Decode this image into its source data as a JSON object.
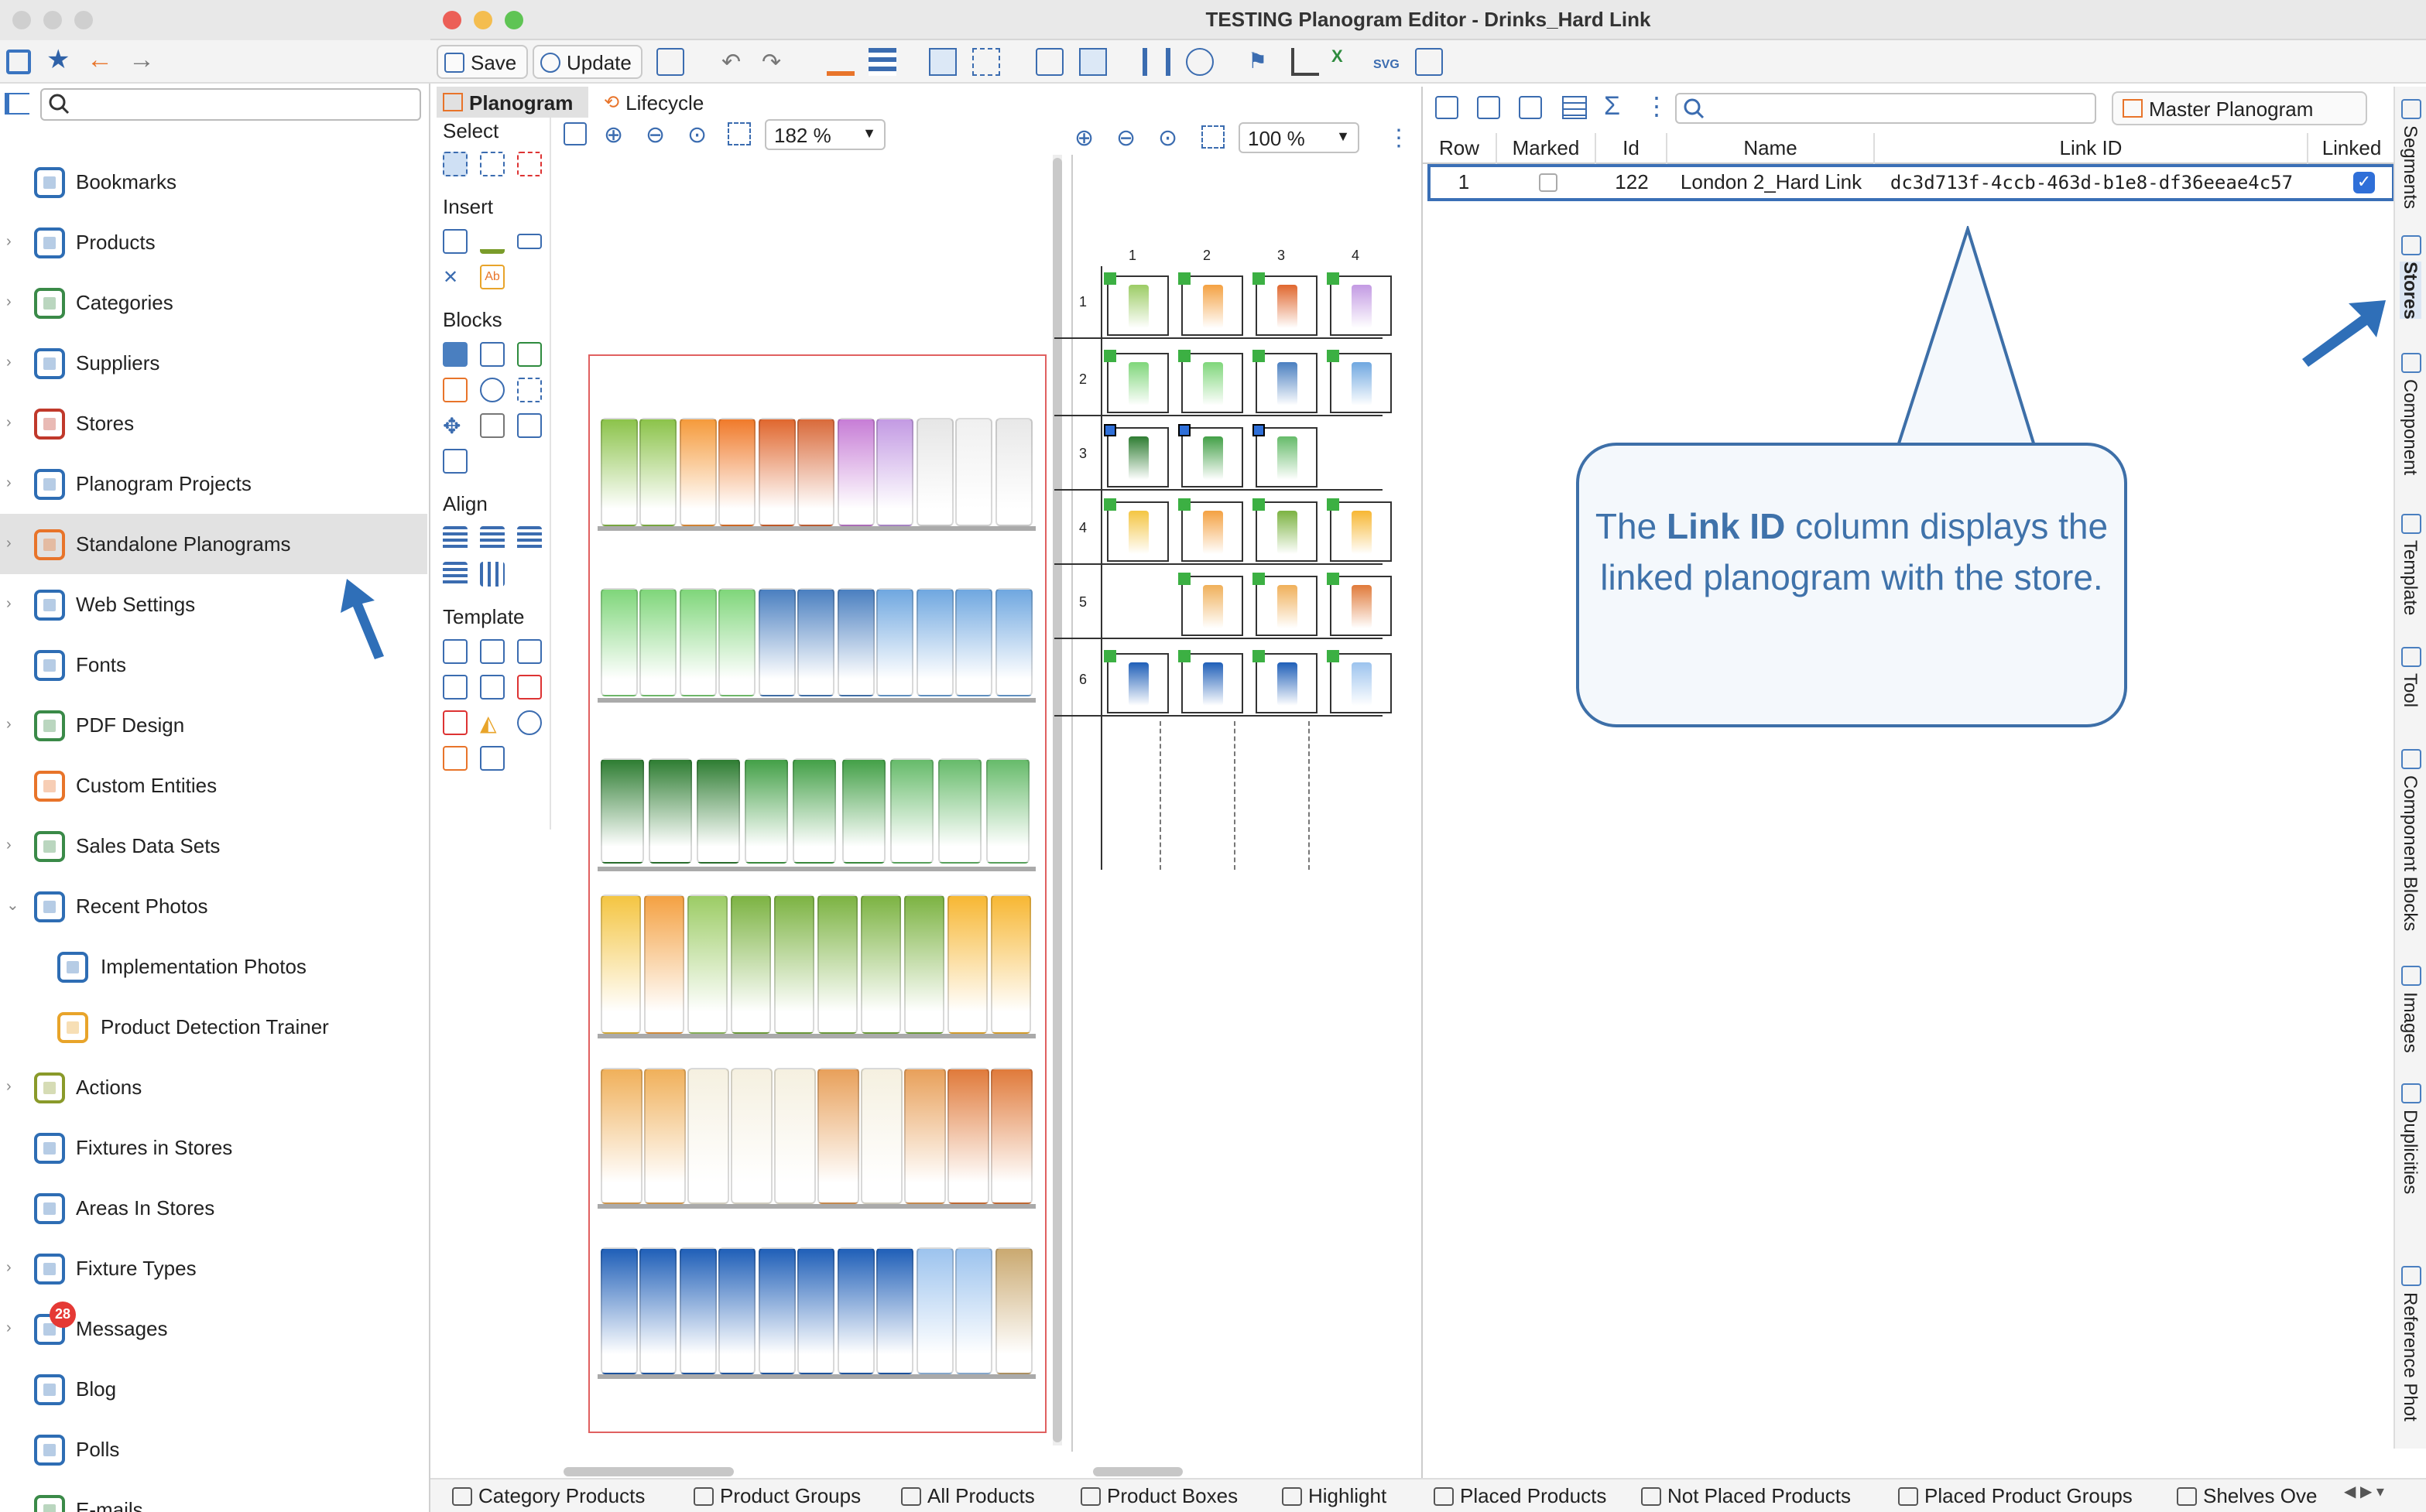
{
  "window": {
    "title": "TESTING Planogram Editor - Drinks_Hard Link"
  },
  "left_nav": {
    "items": [
      {
        "label": "Bookmarks",
        "icon": "bookmark-icon"
      },
      {
        "label": "Products",
        "icon": "products-icon"
      },
      {
        "label": "Categories",
        "icon": "categories-icon"
      },
      {
        "label": "Suppliers",
        "icon": "suppliers-icon"
      },
      {
        "label": "Stores",
        "icon": "store-icon"
      },
      {
        "label": "Planogram Projects",
        "icon": "planogram-projects-icon"
      },
      {
        "label": "Standalone Planograms",
        "icon": "standalone-planogram-icon"
      },
      {
        "label": "Web Settings",
        "icon": "globe-gear-icon"
      },
      {
        "label": "Fonts",
        "icon": "fonts-icon"
      },
      {
        "label": "PDF Design",
        "icon": "pdf-design-icon"
      },
      {
        "label": "Custom Entities",
        "icon": "custom-entities-icon"
      },
      {
        "label": "Sales Data Sets",
        "icon": "sales-data-icon"
      },
      {
        "label": "Recent Photos",
        "icon": "camera-icon"
      },
      {
        "label": "Implementation Photos",
        "icon": "photo-icon"
      },
      {
        "label": "Product Detection Trainer",
        "icon": "detection-trainer-icon"
      },
      {
        "label": "Actions",
        "icon": "actions-icon"
      },
      {
        "label": "Fixtures in Stores",
        "icon": "fixtures-icon"
      },
      {
        "label": "Areas In Stores",
        "icon": "areas-icon"
      },
      {
        "label": "Fixture Types",
        "icon": "fixture-types-icon"
      },
      {
        "label": "Messages",
        "icon": "messages-icon",
        "badge": "28"
      },
      {
        "label": "Blog",
        "icon": "blog-icon"
      },
      {
        "label": "Polls",
        "icon": "polls-icon"
      },
      {
        "label": "E-mails",
        "icon": "email-icon"
      }
    ],
    "selected": "Standalone Planograms"
  },
  "toolbar": {
    "save_label": "Save",
    "update_label": "Update"
  },
  "editor_tabs": {
    "planogram": "Planogram",
    "lifecycle": "Lifecycle"
  },
  "palette": {
    "select": "Select",
    "insert": "Insert",
    "blocks": "Blocks",
    "align": "Align",
    "template": "Template"
  },
  "shelf_view": {
    "zoom": "182 %"
  },
  "grid_view": {
    "zoom": "100 %",
    "columns": [
      "1",
      "2",
      "3",
      "4"
    ],
    "rows": [
      "1",
      "2",
      "3",
      "4",
      "5",
      "6"
    ]
  },
  "master_planogram_label": "Master Planogram",
  "table": {
    "headers": [
      "Row",
      "Marked",
      "Id",
      "Name",
      "Link ID",
      "Linked"
    ],
    "rows": [
      {
        "row": "1",
        "marked": false,
        "id": "122",
        "name": "London 2_Hard Link",
        "link_id": "dc3d713f-4ccb-463d-b1e8-df36eeae4c57",
        "linked": true
      }
    ]
  },
  "callout": {
    "pre": "The ",
    "bold": "Link ID",
    "post": " column displays the linked planogram with the store."
  },
  "side_tabs": [
    "Segments",
    "Stores",
    "Component",
    "Template",
    "Tool",
    "Component Blocks",
    "Images",
    "Duplicities",
    "Reference Phot"
  ],
  "bottom_tabs": [
    "Category Products",
    "Product Groups",
    "All Products",
    "Product Boxes",
    "Highlight",
    "Placed Products",
    "Not Placed Products",
    "Placed Product Groups",
    "Shelves Ove"
  ],
  "colors": {
    "accent": "#3d6fa8",
    "selection_border": "#3a6fb6",
    "fixture_outline": "#e06060",
    "nav_icon": "#2e6db4"
  }
}
